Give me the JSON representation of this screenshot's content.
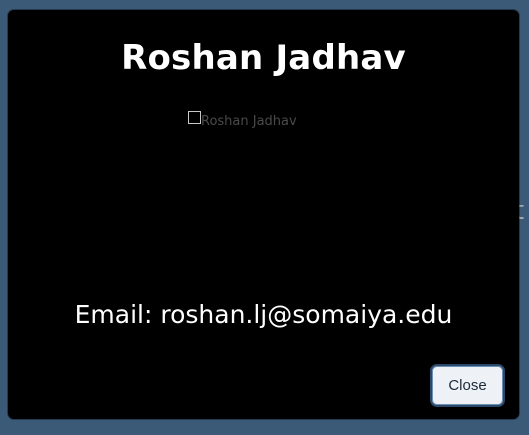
{
  "backdrop": {
    "peek_text": "t"
  },
  "modal": {
    "title": "Roshan Jadhav",
    "image_alt": "Roshan Jadhav",
    "email_line": "Email: roshan.lj@somaiya.edu",
    "close_label": "Close"
  },
  "colors": {
    "backdrop": "#3a5a78",
    "modal_bg": "#000000",
    "button_border": "#2b4a6a",
    "button_bg": "#eef2f7"
  }
}
